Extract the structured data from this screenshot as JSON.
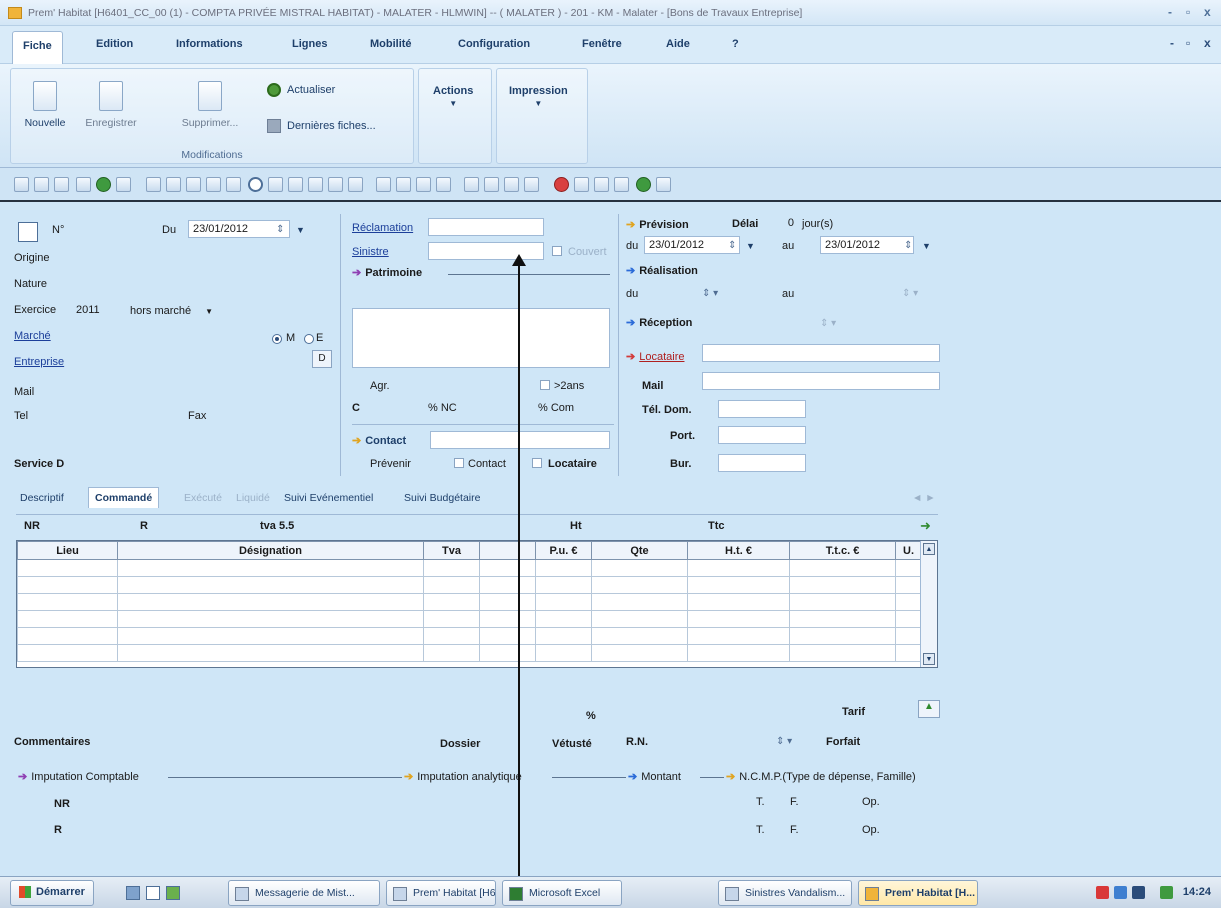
{
  "window": {
    "title": "Prem' Habitat [H6401_CC_00 (1) - COMPTA PRIVÉE MISTRAL HABITAT) - MALATER - HLMWIN] -- ( MALATER ) - 201 - KM - Malater - [Bons de Travaux Entreprise]",
    "controls": [
      "-",
      "▫",
      "x"
    ],
    "mdi_controls": [
      "-",
      "▫",
      "x"
    ]
  },
  "menu": [
    "Fiche",
    "Edition",
    "Informations",
    "Lignes",
    "Mobilité",
    "Configuration",
    "Fenêtre",
    "Aide",
    "?"
  ],
  "ribbon": {
    "nouvelle": "Nouvelle",
    "enregistrer": "Enregistrer",
    "supprimer": "Supprimer...",
    "actualiser": "Actualiser",
    "dernieres": "Dernières fiches...",
    "group_label": "Modifications",
    "actions": "Actions",
    "impression": "Impression"
  },
  "form": {
    "num_label": "N°",
    "du_label": "Du",
    "date_du": "23/01/2012",
    "origine": "Origine",
    "nature": "Nature",
    "exercice_label": "Exercice",
    "exercice_value": "2011",
    "marche_select": "hors marché",
    "marche": "Marché",
    "radio_m": "M",
    "radio_e": "E",
    "entreprise": "Entreprise",
    "entreprise_btn": "D",
    "mail": "Mail",
    "tel": "Tel",
    "fax": "Fax",
    "service": "Service D",
    "reclamation": "Réclamation",
    "sinistre": "Sinistre",
    "couvert": "Couvert",
    "patrimoine": "Patrimoine",
    "agr": "Agr.",
    "deux_ans": ">2ans",
    "c": "C",
    "nc": "% NC",
    "com": "% Com",
    "contact": "Contact",
    "prevenir": "Prévenir",
    "prev_contact": "Contact",
    "prev_locataire": "Locataire",
    "prevision": "Prévision",
    "delai": "Délai",
    "delai_value": "0",
    "jours": "jour(s)",
    "prev_du": "du",
    "prev_date_du": "23/01/2012",
    "prev_au": "au",
    "prev_date_au": "23/01/2012",
    "realisation": "Réalisation",
    "real_du": "du",
    "real_au": "au",
    "reception": "Réception",
    "locataire": "Locataire",
    "loc_mail": "Mail",
    "tel_dom": "Tél. Dom.",
    "port": "Port.",
    "bur": "Bur."
  },
  "subtabs": [
    "Descriptif",
    "Commandé",
    "Exécuté",
    "Liquidé",
    "Suivi Evénementiel",
    "Suivi Budgétaire"
  ],
  "subtab_nav": "◄ ►",
  "summary": {
    "nr": "NR",
    "r": "R",
    "tva": "tva 5.5",
    "ht": "Ht",
    "ttc": "Ttc"
  },
  "grid": {
    "columns": [
      "Lieu",
      "Désignation",
      "Tva",
      "",
      "P.u. €",
      "Qte",
      "H.t. €",
      "T.t.c. €",
      "U."
    ],
    "rows": 6
  },
  "bottom": {
    "percent": "%",
    "tarif": "Tarif",
    "commentaires": "Commentaires",
    "dossier": "Dossier",
    "vetuste": "Vétusté",
    "rn": "R.N.",
    "forfait": "Forfait",
    "imputation_comptable": "Imputation Comptable",
    "imputation_analytique": "Imputation analytique",
    "montant": "Montant",
    "ncmp": "N.C.M.P.(Type de dépense, Famille)",
    "nr": "NR",
    "r": "R",
    "t1": "T.",
    "f1": "F.",
    "op1": "Op.",
    "t2": "T.",
    "f2": "F.",
    "op2": "Op."
  },
  "taskbar": {
    "start": "Démarrer",
    "tasks": [
      "Messagerie de Mist...",
      "Prem' Habitat [H64...",
      "Microsoft Excel",
      "Sinistres Vandalism...",
      "Prem' Habitat [H..."
    ],
    "clock": "14:24"
  }
}
